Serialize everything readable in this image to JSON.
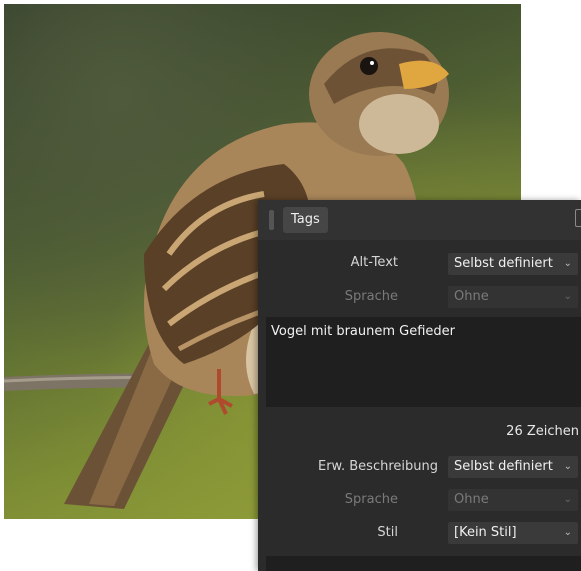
{
  "panel": {
    "tab_label": "Tags",
    "alt_text": {
      "label": "Alt-Text",
      "value": "Selbst definiert",
      "language_label": "Sprache",
      "language_value": "Ohne",
      "text": "Vogel mit braunem Gefieder",
      "char_count": "26 Zeichen"
    },
    "extended": {
      "label": "Erw. Beschreibung",
      "value": "Selbst definiert",
      "language_label": "Sprache",
      "language_value": "Ohne",
      "style_label": "Stil",
      "style_value": "[Kein Stil]"
    },
    "icons": {
      "dropdown": "chevron-down-icon"
    }
  },
  "photo": {
    "subject": "sparrow-photo"
  }
}
